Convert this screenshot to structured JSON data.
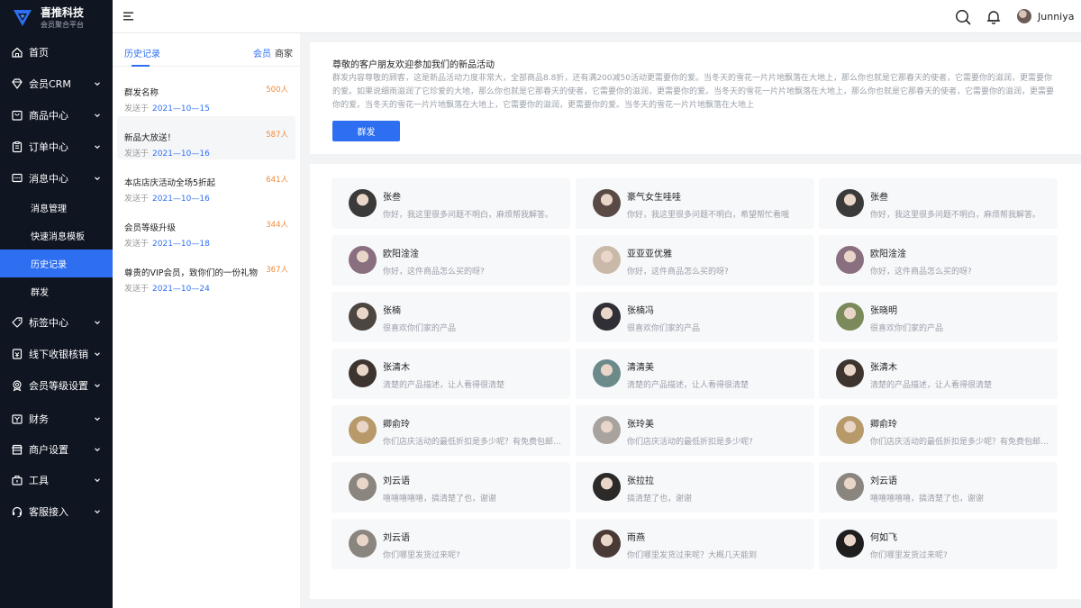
{
  "brand": {
    "name": "喜推科技",
    "subtitle": "会员聚合平台"
  },
  "sidebar": {
    "items": [
      {
        "label": "首页",
        "icon": "home-icon",
        "expandable": false
      },
      {
        "label": "会员CRM",
        "icon": "diamond-icon",
        "expandable": true
      },
      {
        "label": "商品中心",
        "icon": "product-icon",
        "expandable": true
      },
      {
        "label": "订单中心",
        "icon": "order-icon",
        "expandable": true
      },
      {
        "label": "消息中心",
        "icon": "message-icon",
        "expandable": true
      },
      {
        "label": "标签中心",
        "icon": "tag-icon",
        "expandable": true
      },
      {
        "label": "线下收银核销",
        "icon": "cashier-icon",
        "expandable": true
      },
      {
        "label": "会员等级设置",
        "icon": "medal-icon",
        "expandable": true
      },
      {
        "label": "财务",
        "icon": "wallet-icon",
        "expandable": true
      },
      {
        "label": "商户设置",
        "icon": "store-icon",
        "expandable": true
      },
      {
        "label": "工具",
        "icon": "toolbox-icon",
        "expandable": true
      },
      {
        "label": "客服接入",
        "icon": "headset-icon",
        "expandable": true
      }
    ],
    "subitems": [
      {
        "label": "消息管理",
        "active": false
      },
      {
        "label": "快速消息模板",
        "active": false
      },
      {
        "label": "历史记录",
        "active": true
      },
      {
        "label": "群发",
        "active": false
      }
    ]
  },
  "topbar": {
    "user_name": "Junniya"
  },
  "history": {
    "tab": "历史记录",
    "filters": [
      "会员",
      "商家"
    ],
    "sent_prefix": "发送于",
    "items": [
      {
        "title": "群发名称",
        "count": "500人",
        "date": "2021—10—15"
      },
      {
        "title": "新品大放送！",
        "count": "587人",
        "date": "2021—10—16"
      },
      {
        "title": "本店店庆活动全场5折起",
        "count": "641人",
        "date": "2021—10—16"
      },
      {
        "title": "会员等级升级",
        "count": "344人",
        "date": "2021—10—18"
      },
      {
        "title": "尊贵的VIP会员，致你们的一份礼物",
        "count": "367人",
        "date": "2021—10—24"
      }
    ]
  },
  "notice": {
    "title": "尊敬的客户朋友欢迎参加我们的新品活动",
    "body": "群发内容尊敬的顾客，这是新品活动力度非常大，全部商品8.8折，还有满200减50活动更需要你的爱。当冬天的雪花一片片地飘落在大地上，那么你也就是它那春天的使者，它需要你的滋润，更需要你的爱。如果说细雨滋润了它珍爱的大地，那么你也就是它那春天的使者，它需要你的滋润，更需要你的爱。当冬天的雪花一片片地飘落在大地上，那么你也就是它那春天的使者，它需要你的滋润，更需要你的爱。当冬天的雪花一片片地飘落在大地上，它需要你的滋润，更需要你的爱。当冬天的雪花一片片地飘落在大地上",
    "send_label": "群发"
  },
  "conversations": [
    {
      "name": "张叁",
      "message": "你好，我这里很多问题不明白，麻烦帮我解答。",
      "avatar_color": "#3a3a3a"
    },
    {
      "name": "豪气女生哇哇",
      "message": "你好，我这里很多问题不明白，希望帮忙看哦",
      "avatar_color": "#5a4a45"
    },
    {
      "name": "张叁",
      "message": "你好，我这里很多问题不明白，麻烦帮我解答。",
      "avatar_color": "#3a3a3a"
    },
    {
      "name": "欧阳淦淦",
      "message": "你好，这件商品怎么买的呀?",
      "avatar_color": "#8a6f80"
    },
    {
      "name": "亚亚亚优雅",
      "message": "你好，这件商品怎么买的呀?",
      "avatar_color": "#c9b9a8"
    },
    {
      "name": "欧阳淦淦",
      "message": "你好，这件商品怎么买的呀?",
      "avatar_color": "#8a6f80"
    },
    {
      "name": "张楠",
      "message": "很喜欢你们家的产品",
      "avatar_color": "#4d4540"
    },
    {
      "name": "张楠冯",
      "message": "很喜欢你们家的产品",
      "avatar_color": "#2f2f35"
    },
    {
      "name": "张晓明",
      "message": "很喜欢你们家的产品",
      "avatar_color": "#7a8a5a"
    },
    {
      "name": "张清木",
      "message": "清楚的产品描述，让人看得很清楚",
      "avatar_color": "#3d342f"
    },
    {
      "name": "清清美",
      "message": "清楚的产品描述，让人看得很清楚",
      "avatar_color": "#6c8a8a"
    },
    {
      "name": "张清木",
      "message": "清楚的产品描述，让人看得很清楚",
      "avatar_color": "#3d342f"
    },
    {
      "name": "卿俞玲",
      "message": "你们店庆活动的最低折扣是多少呢？有免费包邮吗？",
      "avatar_color": "#b89a6a"
    },
    {
      "name": "张玲美",
      "message": "你们店庆活动的最低折扣是多少呢?",
      "avatar_color": "#a9a3a0"
    },
    {
      "name": "卿俞玲",
      "message": "你们店庆活动的最低折扣是多少呢？有免费包邮吗？",
      "avatar_color": "#b89a6a"
    },
    {
      "name": "刘云语",
      "message": "嘻嘻嘻嘻嘻，搞清楚了也，谢谢",
      "avatar_color": "#8b8580"
    },
    {
      "name": "张拉拉",
      "message": "搞清楚了也，谢谢",
      "avatar_color": "#2c2a28"
    },
    {
      "name": "刘云语",
      "message": "嘻嘻嘻嘻嘻，搞清楚了也，谢谢",
      "avatar_color": "#8b8580"
    },
    {
      "name": "刘云语",
      "message": "你们哪里发货过来呢?",
      "avatar_color": "#8b8580"
    },
    {
      "name": "雨燕",
      "message": "你们哪里发货过来呢？大概几天能到",
      "avatar_color": "#4a3a35"
    },
    {
      "name": "何如飞",
      "message": "你们哪里发货过来呢?",
      "avatar_color": "#1e1e1e"
    }
  ]
}
